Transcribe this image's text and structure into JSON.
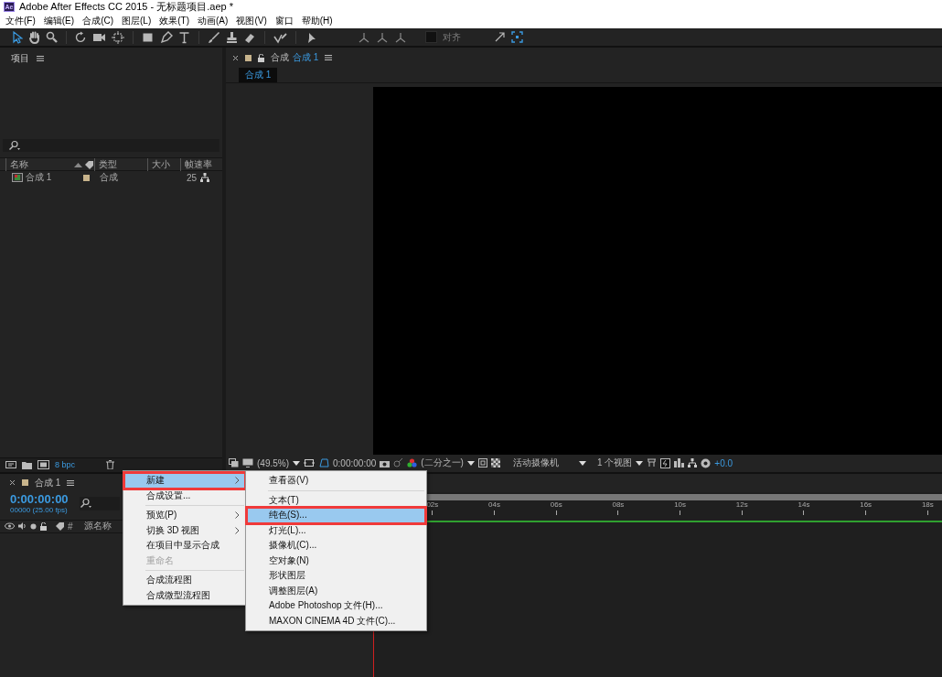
{
  "window": {
    "title": "Adobe After Effects CC 2015 - 无标题项目.aep *",
    "app_badge": "Ae"
  },
  "menu_bar": [
    "文件(F)",
    "编辑(E)",
    "合成(C)",
    "图层(L)",
    "效果(T)",
    "动画(A)",
    "视图(V)",
    "窗口",
    "帮助(H)"
  ],
  "toolbar": {
    "snap": {
      "label": "对齐",
      "checked": false
    }
  },
  "project_panel": {
    "title": "项目",
    "columns": [
      "名称",
      "类型",
      "大小",
      "帧速率"
    ],
    "rows": [
      {
        "name": "合成 1",
        "type": "合成",
        "frame_rate": "25",
        "color": "#c8b48c"
      }
    ],
    "bit_depth": "8 bpc"
  },
  "composition_panel": {
    "tab_prefix": "合成",
    "tab_name": "合成 1",
    "breadcrumb": "合成 1",
    "viewer_bar": {
      "zoom": "(49.5%)",
      "timecode": "0:00:00:00",
      "resolution": "(二分之一)",
      "camera": "活动摄像机",
      "views": "1 个视图",
      "exposure": "+0.0"
    }
  },
  "timeline": {
    "tab": "合成 1",
    "timecode": "0:00:00:00",
    "frame_info": "00000 (25.00 fps)",
    "columns": [
      "#",
      "源名称"
    ],
    "ruler": [
      "02s",
      "04s",
      "06s",
      "08s",
      "10s",
      "12s",
      "14s",
      "16s",
      "18s"
    ]
  },
  "context_menu": {
    "items": [
      {
        "kind": "item",
        "label": "新建",
        "submenu": true,
        "selected": true,
        "disabled": false,
        "annotated": true
      },
      {
        "kind": "item",
        "label": "合成设置...",
        "submenu": false,
        "selected": false,
        "disabled": false,
        "annotated": false
      },
      {
        "kind": "separator"
      },
      {
        "kind": "item",
        "label": "预览(P)",
        "submenu": true,
        "selected": false,
        "disabled": false,
        "annotated": false
      },
      {
        "kind": "item",
        "label": "切换 3D 视图",
        "submenu": true,
        "selected": false,
        "disabled": false,
        "annotated": false
      },
      {
        "kind": "item",
        "label": "在项目中显示合成",
        "submenu": false,
        "selected": false,
        "disabled": false,
        "annotated": false
      },
      {
        "kind": "item",
        "label": "重命名",
        "submenu": false,
        "selected": false,
        "disabled": true,
        "annotated": false
      },
      {
        "kind": "separator"
      },
      {
        "kind": "item",
        "label": "合成流程图",
        "submenu": false,
        "selected": false,
        "disabled": false,
        "annotated": false
      },
      {
        "kind": "item",
        "label": "合成微型流程图",
        "submenu": false,
        "selected": false,
        "disabled": false,
        "annotated": false
      }
    ]
  },
  "submenu": {
    "items": [
      {
        "kind": "item",
        "label": "查看器(V)",
        "submenu": false,
        "selected": false,
        "disabled": false,
        "annotated": false
      },
      {
        "kind": "separator"
      },
      {
        "kind": "item",
        "label": "文本(T)",
        "submenu": false,
        "selected": false,
        "disabled": false,
        "annotated": false
      },
      {
        "kind": "item",
        "label": "纯色(S)...",
        "submenu": false,
        "selected": true,
        "disabled": false,
        "annotated": true
      },
      {
        "kind": "item",
        "label": "灯光(L)...",
        "submenu": false,
        "selected": false,
        "disabled": false,
        "annotated": false
      },
      {
        "kind": "item",
        "label": "摄像机(C)...",
        "submenu": false,
        "selected": false,
        "disabled": false,
        "annotated": false
      },
      {
        "kind": "item",
        "label": "空对象(N)",
        "submenu": false,
        "selected": false,
        "disabled": false,
        "annotated": false
      },
      {
        "kind": "item",
        "label": "形状图层",
        "submenu": false,
        "selected": false,
        "disabled": false,
        "annotated": false
      },
      {
        "kind": "item",
        "label": "调整图层(A)",
        "submenu": false,
        "selected": false,
        "disabled": false,
        "annotated": false
      },
      {
        "kind": "item",
        "label": "Adobe Photoshop 文件(H)...",
        "submenu": false,
        "selected": false,
        "disabled": false,
        "annotated": false
      },
      {
        "kind": "item",
        "label": "MAXON CINEMA 4D 文件(C)...",
        "submenu": false,
        "selected": false,
        "disabled": false,
        "annotated": false
      }
    ]
  }
}
